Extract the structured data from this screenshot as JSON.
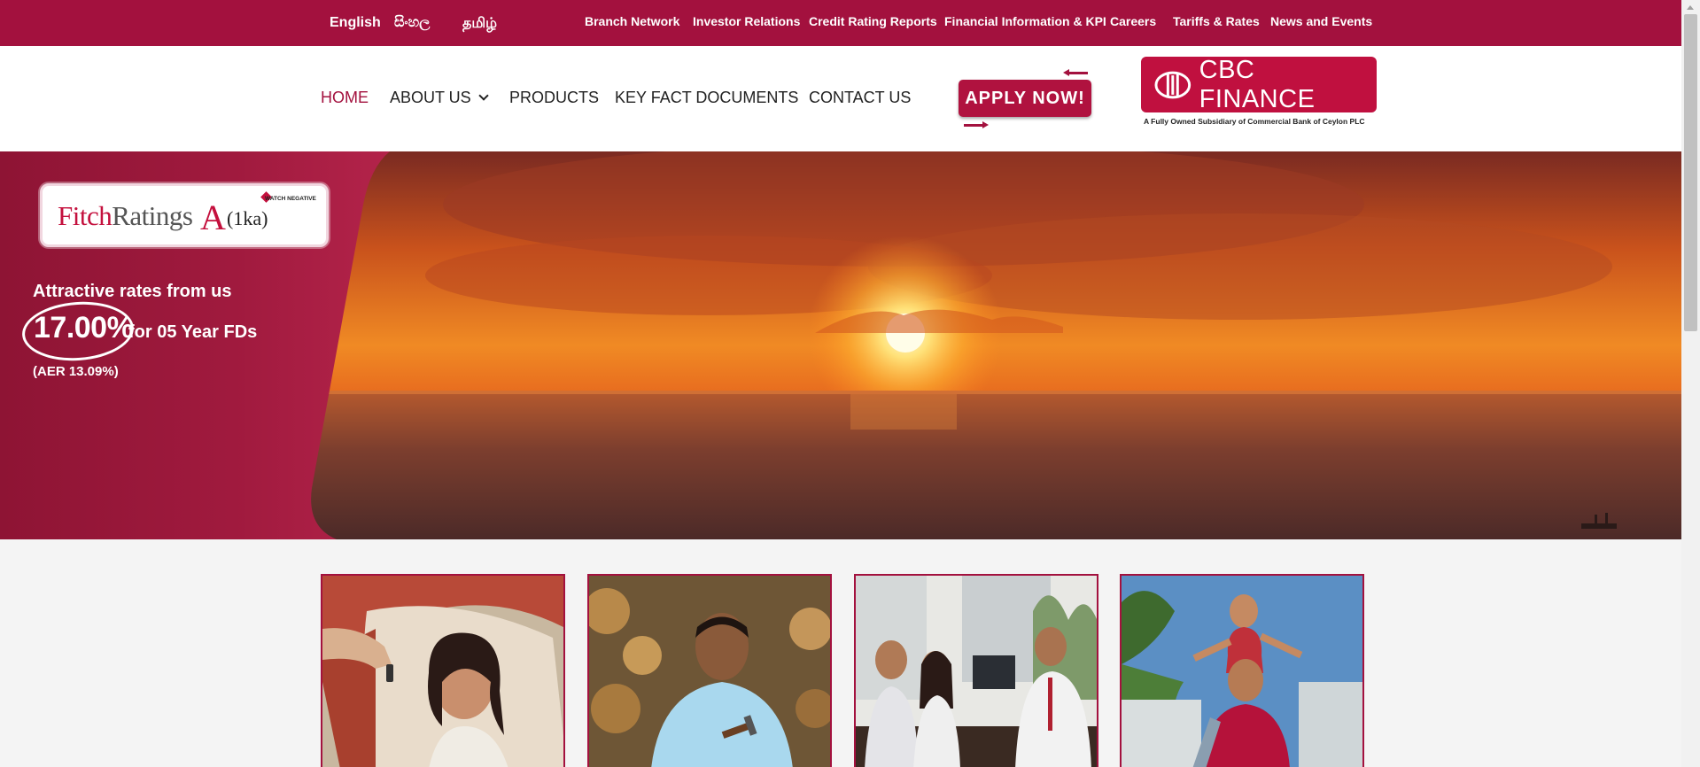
{
  "languages": [
    "English",
    "සිංහල",
    "தமிழ்"
  ],
  "top_links": [
    "Branch Network",
    "Investor Relations",
    "Credit Rating Reports",
    "Financial Information & KPI",
    "Careers",
    "Tariffs & Rates",
    "News and Events"
  ],
  "nav": {
    "items": [
      "HOME",
      "ABOUT US",
      "PRODUCTS",
      "KEY FACT DOCUMENTS",
      "CONTACT US"
    ],
    "active": "HOME",
    "apply_label": "APPLY NOW!"
  },
  "logo": {
    "name": "CBC FINANCE",
    "tagline": "A Fully Owned Subsidiary of Commercial Bank of Ceylon PLC"
  },
  "rating": {
    "agency_first": "Fitch",
    "agency_second": "Ratings",
    "grade": "A",
    "grade_suffix": "(1ka)",
    "watch": "WATCH NEGATIVE"
  },
  "promo": {
    "title": "Attractive rates from us",
    "rate": "17.00%",
    "term": "for 05 Year FDs",
    "aer": "(AER 13.09%)"
  },
  "colors": {
    "brand": "#a3113e",
    "white": "#ffffff"
  }
}
